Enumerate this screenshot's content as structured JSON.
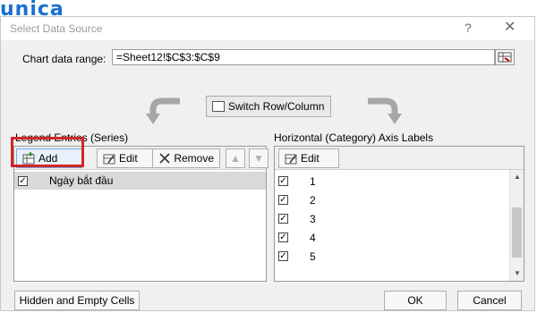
{
  "brand": {
    "logo_text": "unica"
  },
  "dialog": {
    "title": "Select Data Source",
    "help": "?",
    "close": "✕"
  },
  "range": {
    "label": "Chart data range:",
    "value": "=Sheet12!$C$3:$C$9"
  },
  "switch_label": "Switch Row/Column",
  "legend": {
    "label": "Legend Entries (Series)",
    "add": "Add",
    "edit": "Edit",
    "remove": "Remove",
    "series": [
      {
        "name": "Ngày bắt đầu",
        "checked": true
      }
    ]
  },
  "axis": {
    "label": "Horizontal (Category) Axis Labels",
    "edit": "Edit",
    "items": [
      "1",
      "2",
      "3",
      "4",
      "5"
    ]
  },
  "footer": {
    "hidden_empty": "Hidden and Empty Cells",
    "ok": "OK",
    "cancel": "Cancel"
  },
  "colors": {
    "highlight": "#d32626",
    "logo": "#1a6fd1"
  }
}
